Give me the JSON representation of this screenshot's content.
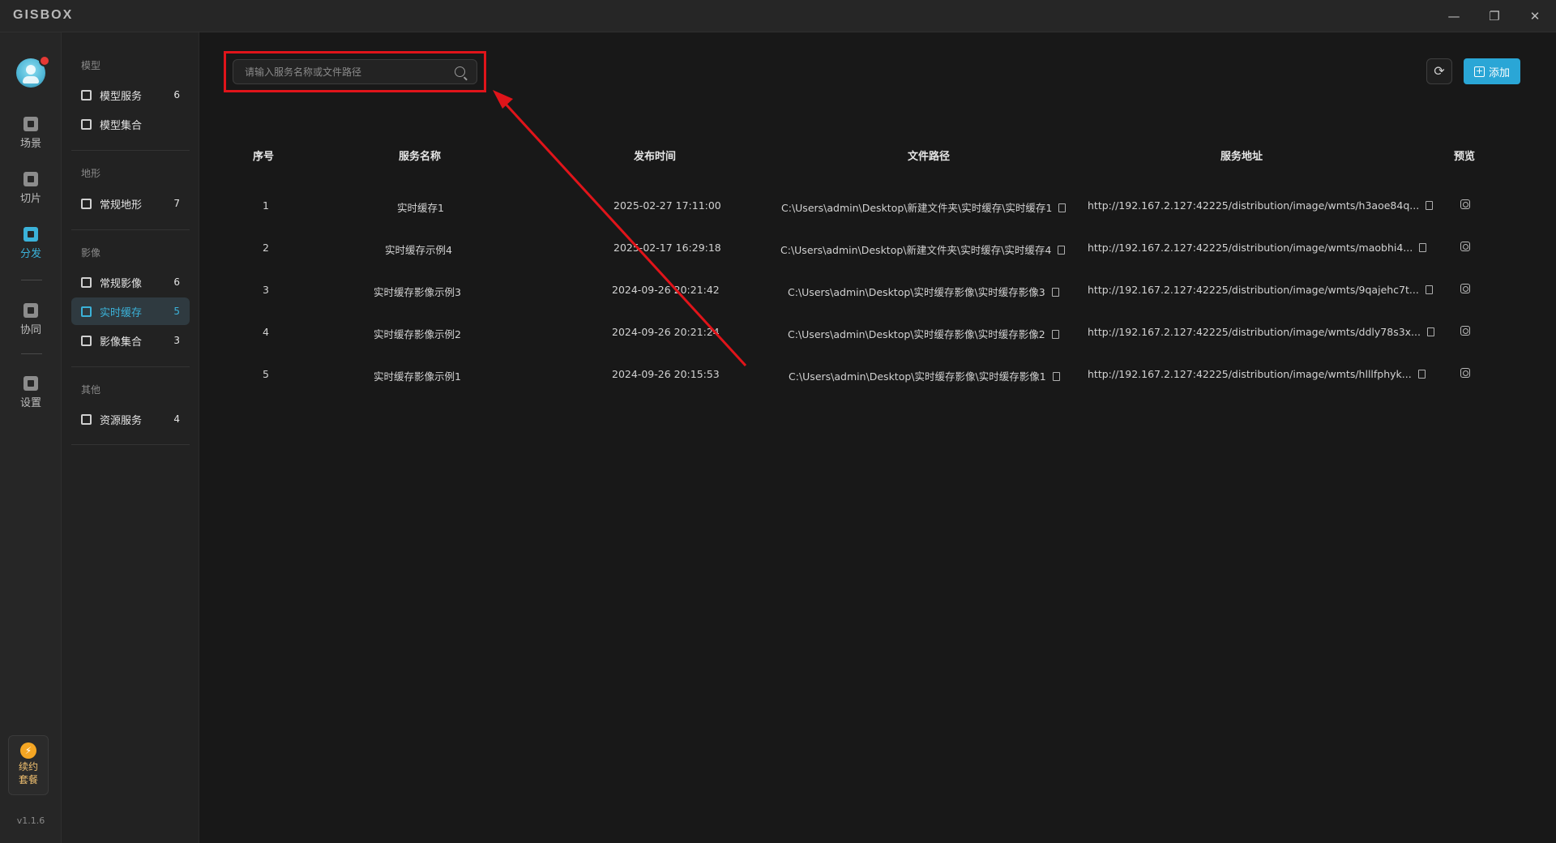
{
  "app": {
    "logo": "GISBOX",
    "version": "v1.1.6"
  },
  "window_controls": [
    "minimize-icon",
    "restore-icon",
    "close-icon"
  ],
  "rail": {
    "items": [
      {
        "label": "场景",
        "icon": "scene-icon"
      },
      {
        "label": "切片",
        "icon": "tile-icon"
      },
      {
        "label": "分发",
        "icon": "distribute-icon",
        "active": true
      },
      {
        "label": "协同",
        "icon": "collab-icon"
      },
      {
        "label": "设置",
        "icon": "settings-icon"
      }
    ],
    "renew_label_1": "续约",
    "renew_label_2": "套餐"
  },
  "sidebar": {
    "groups": [
      {
        "title": "模型",
        "items": [
          {
            "label": "模型服务",
            "count": "6"
          },
          {
            "label": "模型集合",
            "count": ""
          }
        ]
      },
      {
        "title": "地形",
        "items": [
          {
            "label": "常规地形",
            "count": "7"
          }
        ]
      },
      {
        "title": "影像",
        "items": [
          {
            "label": "常规影像",
            "count": "6"
          },
          {
            "label": "实时缓存",
            "count": "5",
            "active": true
          },
          {
            "label": "影像集合",
            "count": "3"
          }
        ]
      },
      {
        "title": "其他",
        "items": [
          {
            "label": "资源服务",
            "count": "4"
          }
        ]
      }
    ]
  },
  "toolbar": {
    "search_placeholder": "请输入服务名称或文件路径",
    "refresh_icon": "⟳",
    "add_label": "添加"
  },
  "table": {
    "headers": [
      "序号",
      "服务名称",
      "发布时间",
      "文件路径",
      "服务地址",
      "预览"
    ],
    "rows": [
      {
        "index": "1",
        "name": "实时缓存1",
        "time": "2025-02-27 17:11:00",
        "path": "C:\\Users\\admin\\Desktop\\新建文件夹\\实时缓存\\实时缓存1",
        "url": "http://192.167.2.127:42225/distribution/image/wmts/h3aoe84q..."
      },
      {
        "index": "2",
        "name": "实时缓存示例4",
        "time": "2025-02-17 16:29:18",
        "path": "C:\\Users\\admin\\Desktop\\新建文件夹\\实时缓存\\实时缓存4",
        "url": "http://192.167.2.127:42225/distribution/image/wmts/maobhi4..."
      },
      {
        "index": "3",
        "name": "实时缓存影像示例3",
        "time": "2024-09-26 20:21:42",
        "path": "C:\\Users\\admin\\Desktop\\实时缓存影像\\实时缓存影像3",
        "url": "http://192.167.2.127:42225/distribution/image/wmts/9qajehc7t..."
      },
      {
        "index": "4",
        "name": "实时缓存影像示例2",
        "time": "2024-09-26 20:21:24",
        "path": "C:\\Users\\admin\\Desktop\\实时缓存影像\\实时缓存影像2",
        "url": "http://192.167.2.127:42225/distribution/image/wmts/ddly78s3x..."
      },
      {
        "index": "5",
        "name": "实时缓存影像示例1",
        "time": "2024-09-26 20:15:53",
        "path": "C:\\Users\\admin\\Desktop\\实时缓存影像\\实时缓存影像1",
        "url": "http://192.167.2.127:42225/distribution/image/wmts/hlllfphyk..."
      }
    ]
  },
  "annotation": {
    "color": "#e0141a"
  },
  "colors": {
    "accent": "#3bb2d9",
    "add_button": "#2aa6d6"
  }
}
